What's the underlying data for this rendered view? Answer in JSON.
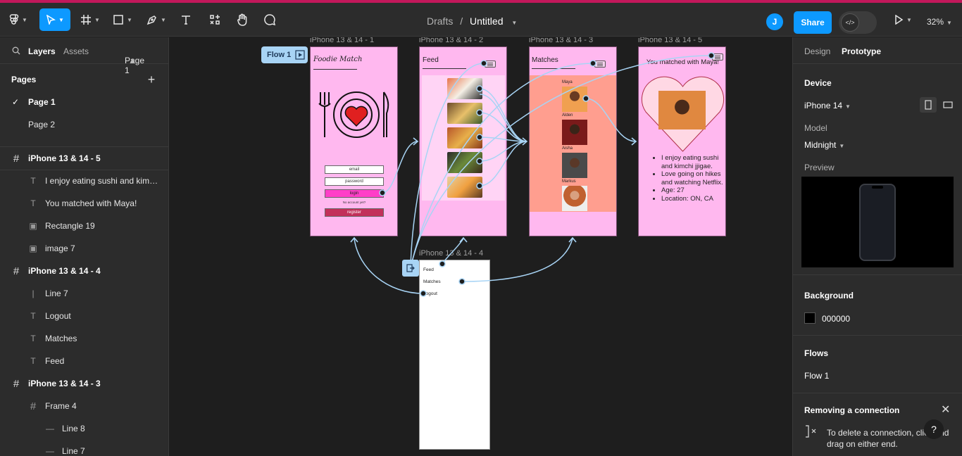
{
  "toolbar": {
    "doc_location": "Drafts",
    "doc_separator": "/",
    "doc_name": "Untitled",
    "avatar_initial": "J",
    "share_label": "Share",
    "zoom": "32%"
  },
  "left_panel": {
    "tabs": {
      "layers": "Layers",
      "assets": "Assets",
      "page_selector": "Page 1"
    },
    "pages_heading": "Pages",
    "pages": [
      {
        "label": "Page 1",
        "selected": true
      },
      {
        "label": "Page 2",
        "selected": false
      }
    ],
    "layers": [
      {
        "label": "iPhone 13 & 14 - 5",
        "icon": "frame-icon",
        "level": 0
      },
      {
        "label": "I enjoy eating sushi and kimchi jjigae. Love going on hikes",
        "icon": "text-icon",
        "level": 1
      },
      {
        "label": "You matched with Maya!",
        "icon": "text-icon",
        "level": 1
      },
      {
        "label": "Rectangle 19",
        "icon": "image-icon",
        "level": 1
      },
      {
        "label": "image 7",
        "icon": "image-icon",
        "level": 1
      },
      {
        "label": "iPhone 13 & 14 - 4",
        "icon": "frame-icon",
        "level": 0
      },
      {
        "label": "Line 7",
        "icon": "line-icon",
        "level": 1
      },
      {
        "label": "Logout",
        "icon": "text-icon",
        "level": 1
      },
      {
        "label": "Matches",
        "icon": "text-icon",
        "level": 1
      },
      {
        "label": "Feed",
        "icon": "text-icon",
        "level": 1
      },
      {
        "label": "iPhone 13 & 14 - 3",
        "icon": "frame-icon",
        "level": 0
      },
      {
        "label": "Frame 4",
        "icon": "frame-icon",
        "level": 1
      },
      {
        "label": "Line 8",
        "icon": "line-icon",
        "level": 2
      },
      {
        "label": "Line 7",
        "icon": "line-icon",
        "level": 2
      }
    ]
  },
  "canvas": {
    "flow_tag": "Flow 1",
    "frames": {
      "f1": "iPhone 13 & 14 - 1",
      "f2": "iPhone 13 & 14 - 2",
      "f3": "iPhone 13 & 14 - 3",
      "f5": "iPhone 13 & 14 - 5",
      "f4": "iPhone 13 & 14 - 4"
    },
    "login": {
      "logo": "Foodie Match",
      "email": "email",
      "password": "password",
      "login": "login",
      "no_account": "No account yet?",
      "register": "register"
    },
    "feed_title": "Feed",
    "matches_title": "Matches",
    "matches": [
      "Maya",
      "Alden",
      "Aisha",
      "Markus"
    ],
    "profile": {
      "title": "You matched with Maya!",
      "bullets": [
        "I enjoy eating sushi and kimchi jjigae.",
        "Love going on hikes and watching Netflix.",
        "Age: 27",
        "Location: ON, CA"
      ]
    },
    "menu": [
      "Feed",
      "Matches",
      "Logout"
    ],
    "colors": {
      "frame_pink": "#ffb8ef",
      "salmon": "#ff9e8f",
      "accent_magenta": "#ff3ec8",
      "register_red": "#c2305a",
      "connector": "#a8d4f5"
    }
  },
  "right_panel": {
    "tabs": {
      "design": "Design",
      "prototype": "Prototype"
    },
    "device_heading": "Device",
    "device_value": "iPhone 14",
    "model_label": "Model",
    "model_value": "Midnight",
    "preview_label": "Preview",
    "background_heading": "Background",
    "background_value": "000000",
    "flows_heading": "Flows",
    "flow_item": "Flow 1",
    "tip_heading": "Removing a connection",
    "tip_text": "To delete a connection, click and drag on either end.",
    "help": "?"
  }
}
